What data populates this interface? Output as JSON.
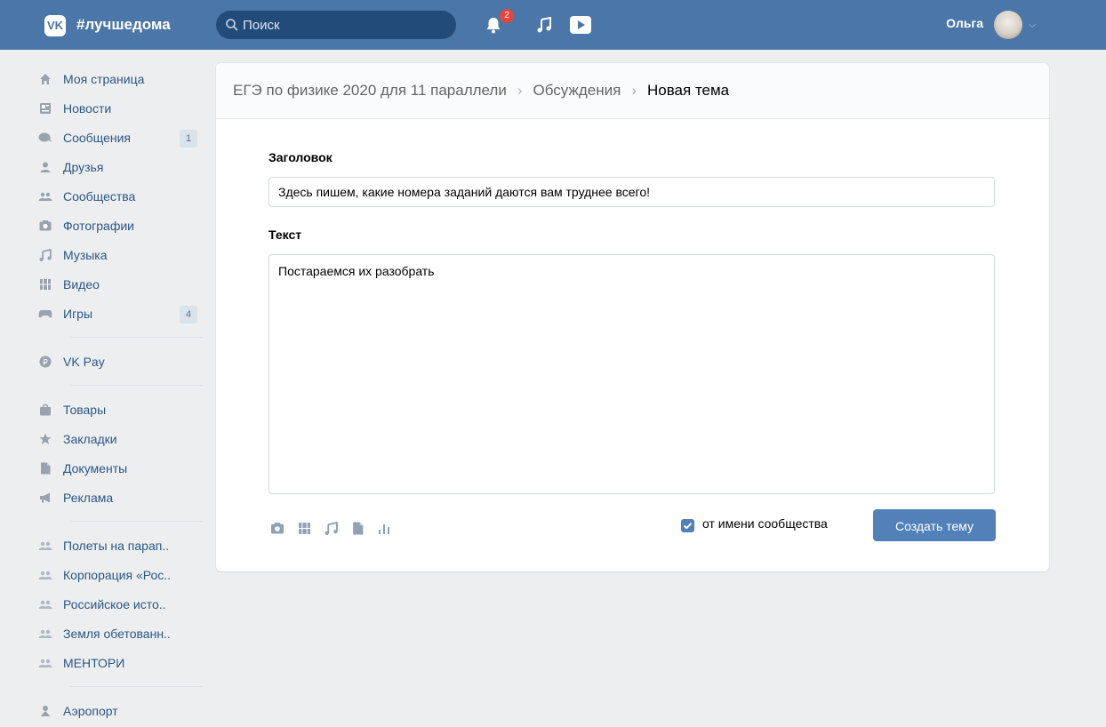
{
  "header": {
    "logo_text": "VK",
    "brand": "#лучшедома",
    "search_placeholder": "Поиск",
    "notifications_count": "2",
    "user_name": "Ольга"
  },
  "sidebar": {
    "items": [
      {
        "label": "Моя страница",
        "icon": "home-icon"
      },
      {
        "label": "Новости",
        "icon": "news-icon"
      },
      {
        "label": "Сообщения",
        "icon": "messages-icon",
        "count": "1"
      },
      {
        "label": "Друзья",
        "icon": "friends-icon"
      },
      {
        "label": "Сообщества",
        "icon": "communities-icon"
      },
      {
        "label": "Фотографии",
        "icon": "camera-icon"
      },
      {
        "label": "Музыка",
        "icon": "music-icon"
      },
      {
        "label": "Видео",
        "icon": "video-icon"
      },
      {
        "label": "Игры",
        "icon": "gamepad-icon",
        "count": "4"
      }
    ],
    "pay": {
      "label": "VK Pay",
      "icon": "vkpay-icon"
    },
    "extra": [
      {
        "label": "Товары",
        "icon": "bag-icon"
      },
      {
        "label": "Закладки",
        "icon": "star-icon"
      },
      {
        "label": "Документы",
        "icon": "document-icon"
      },
      {
        "label": "Реклама",
        "icon": "megaphone-icon"
      }
    ],
    "groups": [
      {
        "label": "Полеты на парап.."
      },
      {
        "label": "Корпорация «Рос.."
      },
      {
        "label": "Российское исто.."
      },
      {
        "label": "Земля обетованн.."
      },
      {
        "label": "МЕНТОРИ"
      }
    ],
    "last": {
      "label": "Аэропорт",
      "icon": "app-icon"
    }
  },
  "breadcrumb": {
    "group": "ЕГЭ по физике 2020 для 11 параллели",
    "section": "Обсуждения",
    "current": "Новая тема",
    "separator": "›"
  },
  "form": {
    "title_label": "Заголовок",
    "title_value": "Здесь пишем, какие номера заданий даются вам труднее всего!",
    "text_label": "Текст",
    "text_value": "Постараемся их разобрать",
    "checkbox_label": "от имени сообщества",
    "checkbox_checked": true,
    "submit_label": "Создать тему",
    "attach_icons": [
      "camera-icon",
      "video-icon",
      "music-icon",
      "document-icon",
      "poll-icon"
    ]
  },
  "colors": {
    "header_bg": "#4a76a8",
    "page_bg": "#edeef0",
    "link": "#2a5885",
    "button": "#5181b8",
    "badge": "#e6463a"
  }
}
